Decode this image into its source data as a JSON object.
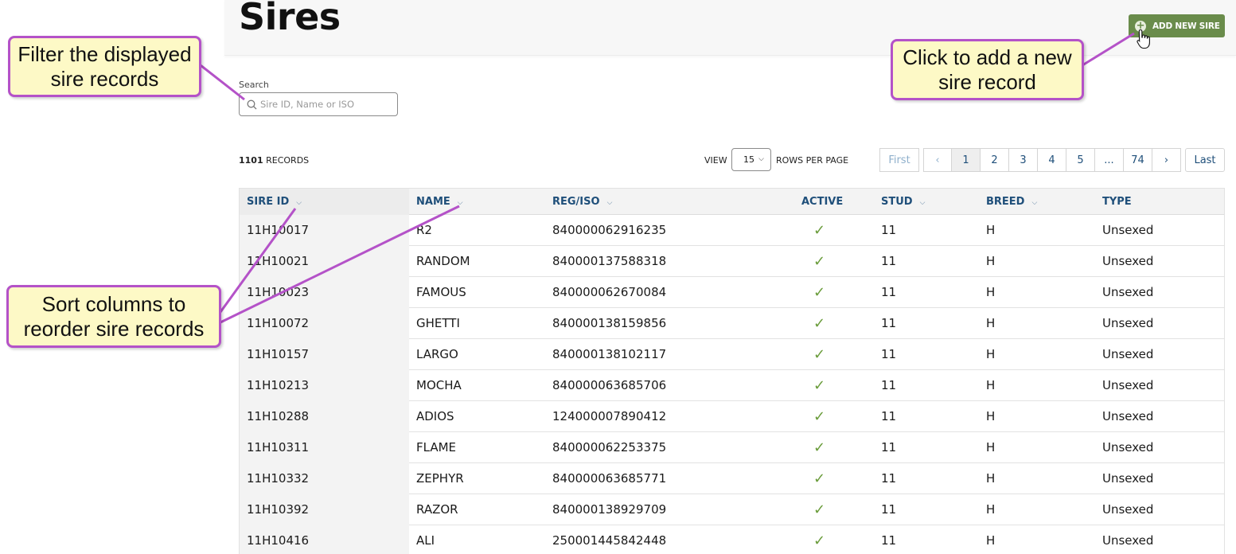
{
  "page": {
    "title": "Sires"
  },
  "toolbar": {
    "add_label": "ADD NEW SIRE"
  },
  "search": {
    "label": "Search",
    "placeholder": "Sire ID, Name or ISO",
    "value": ""
  },
  "records": {
    "count": "1101",
    "suffix": "RECORDS"
  },
  "view": {
    "label": "VIEW",
    "selected": "15",
    "suffix": "ROWS PER PAGE"
  },
  "pagination": {
    "first": "First",
    "prev": "‹",
    "pages": [
      "1",
      "2",
      "3",
      "4",
      "5",
      "...",
      "74"
    ],
    "next": "›",
    "last": "Last",
    "current": "1"
  },
  "table": {
    "headers": {
      "sire_id": "SIRE ID",
      "name": "NAME",
      "reg_iso": "REG/ISO",
      "active": "ACTIVE",
      "stud": "STUD",
      "breed": "BREED",
      "type": "TYPE"
    },
    "rows": [
      {
        "sire_id": "11H10017",
        "name": "R2",
        "reg_iso": "840000062916235",
        "active": true,
        "stud": "11",
        "breed": "H",
        "type": "Unsexed"
      },
      {
        "sire_id": "11H10021",
        "name": "RANDOM",
        "reg_iso": "840000137588318",
        "active": true,
        "stud": "11",
        "breed": "H",
        "type": "Unsexed"
      },
      {
        "sire_id": "11H10023",
        "name": "FAMOUS",
        "reg_iso": "840000062670084",
        "active": true,
        "stud": "11",
        "breed": "H",
        "type": "Unsexed"
      },
      {
        "sire_id": "11H10072",
        "name": "GHETTI",
        "reg_iso": "840000138159856",
        "active": true,
        "stud": "11",
        "breed": "H",
        "type": "Unsexed"
      },
      {
        "sire_id": "11H10157",
        "name": "LARGO",
        "reg_iso": "840000138102117",
        "active": true,
        "stud": "11",
        "breed": "H",
        "type": "Unsexed"
      },
      {
        "sire_id": "11H10213",
        "name": "MOCHA",
        "reg_iso": "840000063685706",
        "active": true,
        "stud": "11",
        "breed": "H",
        "type": "Unsexed"
      },
      {
        "sire_id": "11H10288",
        "name": "ADIOS",
        "reg_iso": "124000007890412",
        "active": true,
        "stud": "11",
        "breed": "H",
        "type": "Unsexed"
      },
      {
        "sire_id": "11H10311",
        "name": "FLAME",
        "reg_iso": "840000062253375",
        "active": true,
        "stud": "11",
        "breed": "H",
        "type": "Unsexed"
      },
      {
        "sire_id": "11H10332",
        "name": "ZEPHYR",
        "reg_iso": "840000063685771",
        "active": true,
        "stud": "11",
        "breed": "H",
        "type": "Unsexed"
      },
      {
        "sire_id": "11H10392",
        "name": "RAZOR",
        "reg_iso": "840000138929709",
        "active": true,
        "stud": "11",
        "breed": "H",
        "type": "Unsexed"
      },
      {
        "sire_id": "11H10416",
        "name": "ALI",
        "reg_iso": "250001445842448",
        "active": true,
        "stud": "11",
        "breed": "H",
        "type": "Unsexed"
      }
    ]
  },
  "callouts": {
    "filter": [
      "Filter the displayed",
      "sire records"
    ],
    "add": [
      "Click to add a new",
      "sire record"
    ],
    "sort": [
      "Sort columns to",
      "reorder sire records"
    ]
  },
  "colors": {
    "accent": "#6a8c4b",
    "link": "#1f4f7a",
    "callout_border": "#b452c8",
    "callout_fill": "#fdf9c6",
    "check": "#6a9c3b"
  },
  "icons": {
    "search": "search-icon",
    "add": "plus-circle-icon",
    "sort": "chevron-down-icon",
    "active": "checkmark-icon",
    "cursor": "hand-pointer-icon"
  }
}
